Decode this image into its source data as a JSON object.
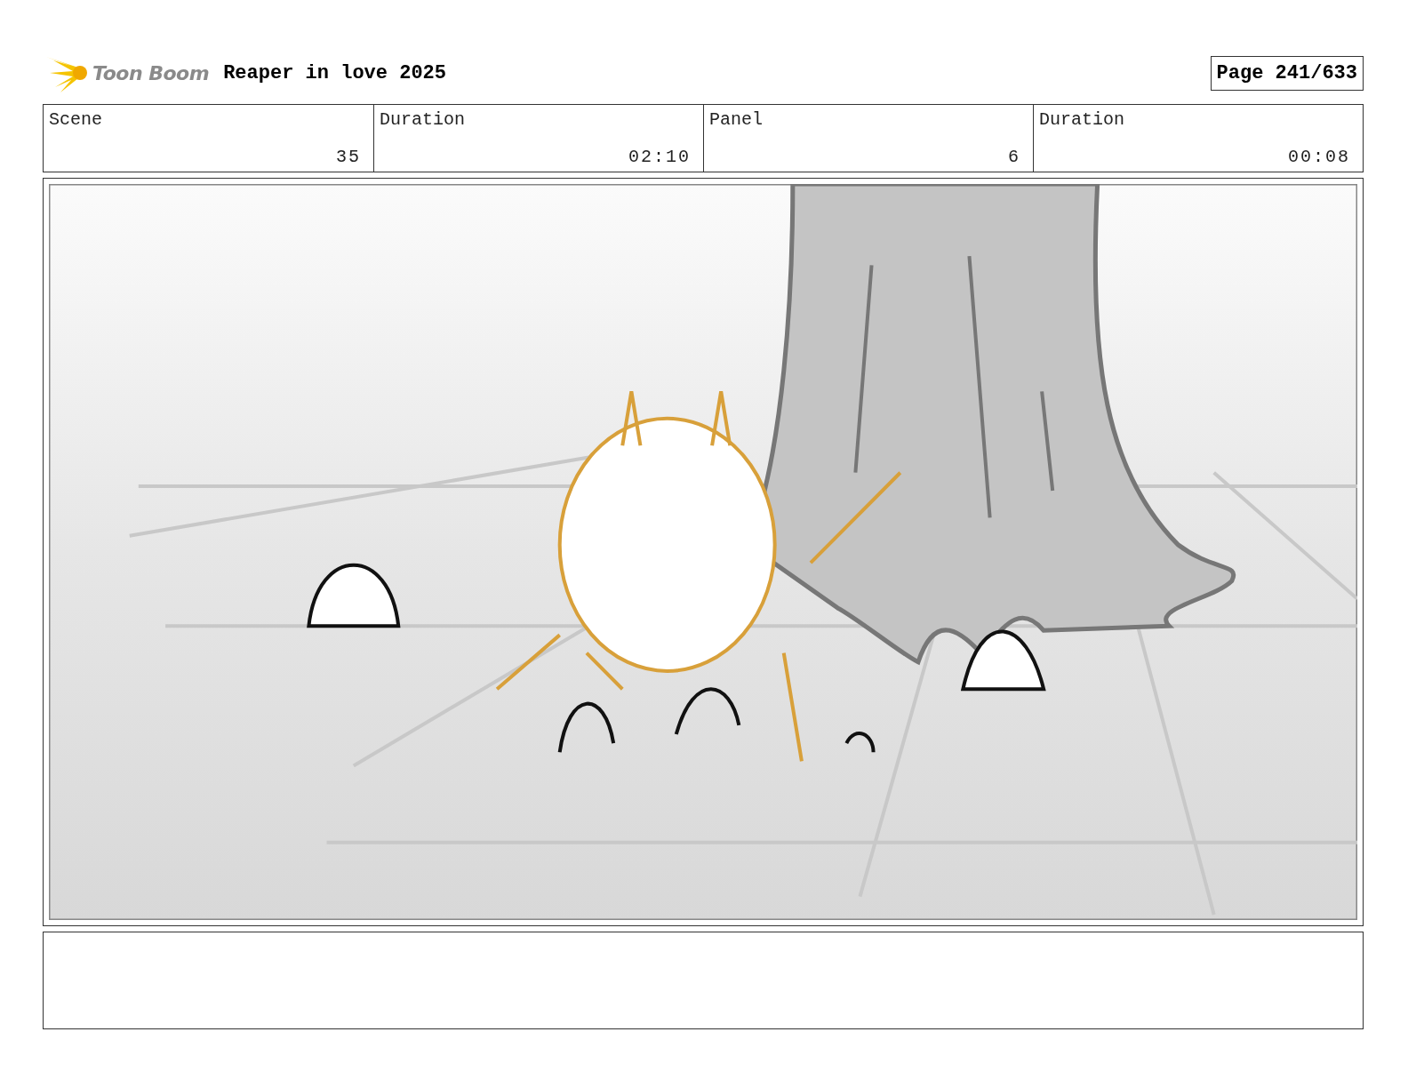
{
  "header": {
    "logo": "Toon Boom",
    "title": "Reaper in love 2025",
    "page": "Page 241/633"
  },
  "info": [
    {
      "label": "Scene",
      "value": "35"
    },
    {
      "label": "Duration",
      "value": "02:10"
    },
    {
      "label": "Panel",
      "value": "6"
    },
    {
      "label": "Duration",
      "value": "00:08"
    }
  ]
}
